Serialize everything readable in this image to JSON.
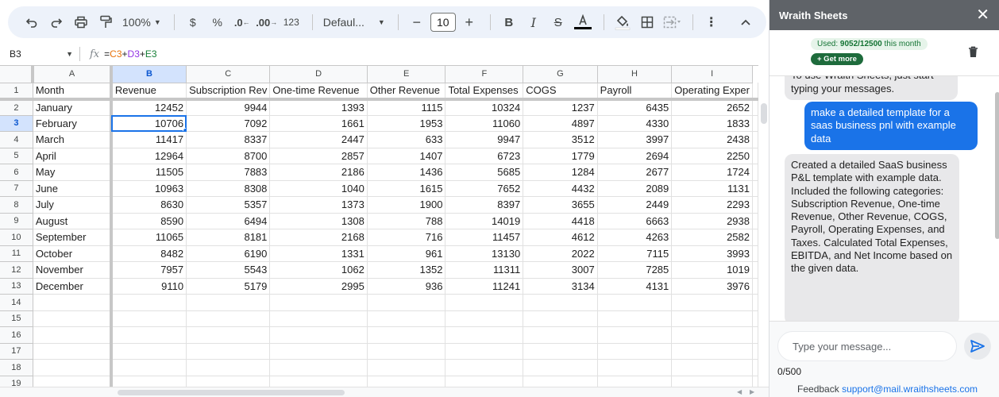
{
  "toolbar": {
    "zoom": "100%",
    "currency": "$",
    "percent": "%",
    "decrease_decimal": ".0",
    "increase_decimal": ".00",
    "number_format": "123",
    "font": "Defaul...",
    "font_size": "10"
  },
  "formula_bar": {
    "cell_ref": "B3",
    "formula_eq": "=",
    "formula_c": "C3",
    "formula_plus1": "+",
    "formula_d": "D3",
    "formula_plus2": "+",
    "formula_e": "E3"
  },
  "sheet": {
    "columns": [
      "A",
      "B",
      "C",
      "D",
      "E",
      "F",
      "G",
      "H",
      "I"
    ],
    "rows": [
      {
        "n": "1",
        "cells": [
          "Month",
          "Revenue",
          "Subscription Rev",
          "One-time Revenue",
          "Other Revenue",
          "Total Expenses",
          "COGS",
          "Payroll",
          "Operating Exper"
        ]
      },
      {
        "n": "2",
        "cells": [
          "January",
          "12452",
          "9944",
          "1393",
          "1115",
          "10324",
          "1237",
          "6435",
          "2652"
        ]
      },
      {
        "n": "3",
        "cells": [
          "February",
          "10706",
          "7092",
          "1661",
          "1953",
          "11060",
          "4897",
          "4330",
          "1833"
        ]
      },
      {
        "n": "4",
        "cells": [
          "March",
          "11417",
          "8337",
          "2447",
          "633",
          "9947",
          "3512",
          "3997",
          "2438"
        ]
      },
      {
        "n": "5",
        "cells": [
          "April",
          "12964",
          "8700",
          "2857",
          "1407",
          "6723",
          "1779",
          "2694",
          "2250"
        ]
      },
      {
        "n": "6",
        "cells": [
          "May",
          "11505",
          "7883",
          "2186",
          "1436",
          "5685",
          "1284",
          "2677",
          "1724"
        ]
      },
      {
        "n": "7",
        "cells": [
          "June",
          "10963",
          "8308",
          "1040",
          "1615",
          "7652",
          "4432",
          "2089",
          "1131"
        ]
      },
      {
        "n": "8",
        "cells": [
          "July",
          "8630",
          "5357",
          "1373",
          "1900",
          "8397",
          "3655",
          "2449",
          "2293"
        ]
      },
      {
        "n": "9",
        "cells": [
          "August",
          "8590",
          "6494",
          "1308",
          "788",
          "14019",
          "4418",
          "6663",
          "2938"
        ]
      },
      {
        "n": "10",
        "cells": [
          "September",
          "11065",
          "8181",
          "2168",
          "716",
          "11457",
          "4612",
          "4263",
          "2582"
        ]
      },
      {
        "n": "11",
        "cells": [
          "October",
          "8482",
          "6190",
          "1331",
          "961",
          "13130",
          "2022",
          "7115",
          "3993"
        ]
      },
      {
        "n": "12",
        "cells": [
          "November",
          "7957",
          "5543",
          "1062",
          "1352",
          "11311",
          "3007",
          "7285",
          "1019"
        ]
      },
      {
        "n": "13",
        "cells": [
          "December",
          "9110",
          "5179",
          "2995",
          "936",
          "11241",
          "3134",
          "4131",
          "3976"
        ]
      },
      {
        "n": "14",
        "cells": [
          "",
          "",
          "",
          "",
          "",
          "",
          "",
          "",
          ""
        ]
      },
      {
        "n": "15",
        "cells": [
          "",
          "",
          "",
          "",
          "",
          "",
          "",
          "",
          ""
        ]
      },
      {
        "n": "16",
        "cells": [
          "",
          "",
          "",
          "",
          "",
          "",
          "",
          "",
          ""
        ]
      },
      {
        "n": "17",
        "cells": [
          "",
          "",
          "",
          "",
          "",
          "",
          "",
          "",
          ""
        ]
      },
      {
        "n": "18",
        "cells": [
          "",
          "",
          "",
          "",
          "",
          "",
          "",
          "",
          ""
        ]
      },
      {
        "n": "19",
        "cells": [
          "",
          "",
          "",
          "",
          "",
          "",
          "",
          "",
          ""
        ]
      }
    ]
  },
  "panel": {
    "title": "Wraith Sheets",
    "usage_prefix": "Used: ",
    "usage_value": "9052/12500",
    "usage_suffix": " this month",
    "get_more": "+ Get more",
    "messages": [
      {
        "role": "assistant",
        "text": "To use Wraith Sheets, just start typing your messages."
      },
      {
        "role": "user",
        "text": "make a detailed template for a saas business pnl with example data"
      },
      {
        "role": "assistant",
        "text": "Created a detailed SaaS business P&L template with example data. Included the following categories: Subscription Revenue, One-time Revenue, Other Revenue, COGS, Payroll, Operating Expenses, and Taxes. Calculated Total Expenses, EBITDA, and Net Income based on the given data."
      }
    ],
    "input_placeholder": "Type your message...",
    "char_count": "0/500",
    "feedback_label": "Feedback",
    "feedback_email": "support@mail.wraithsheets.com"
  },
  "colors": {
    "accent": "#1a73e8",
    "panel_header": "#5f6368",
    "selection": "#d3e3fd"
  },
  "selection": {
    "row": "3",
    "col": "B"
  }
}
